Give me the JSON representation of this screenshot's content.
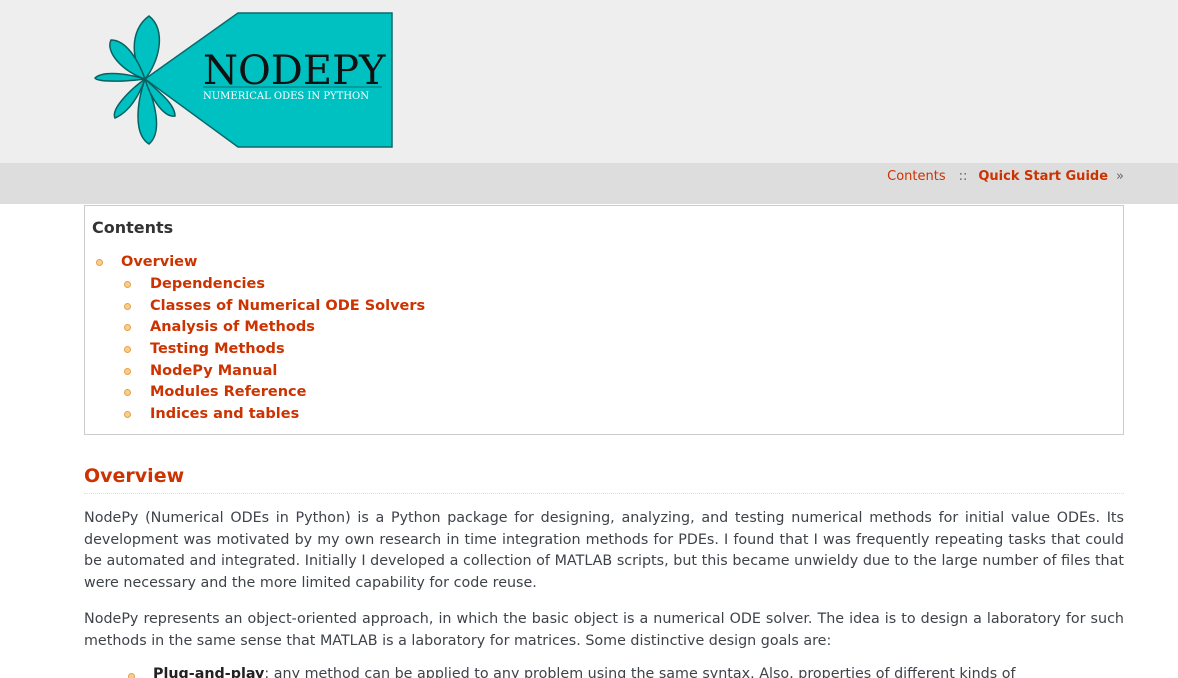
{
  "header": {
    "logo": {
      "title": "NODEPY",
      "subtitle": "NUMERICAL ODES IN PYTHON",
      "icon": "flower-logo-icon",
      "color": "#00c1c1"
    }
  },
  "relbar": {
    "contents_label": "Contents",
    "separator": "::",
    "next_label": "Quick Start Guide",
    "next_arrow": "»"
  },
  "toc": {
    "title": "Contents",
    "top_item": "Overview",
    "items": [
      "Dependencies",
      "Classes of Numerical ODE Solvers",
      "Analysis of Methods",
      "Testing Methods",
      "NodePy Manual",
      "Modules Reference",
      "Indices and tables"
    ]
  },
  "main": {
    "heading": "Overview",
    "para1": "NodePy (Numerical ODEs in Python) is a Python package for designing, analyzing, and testing numerical methods for initial value ODEs. Its development was motivated by my own research in time integration methods for PDEs. I found that I was frequently repeating tasks that could be automated and integrated. Initially I developed a collection of MATLAB scripts, but this became unwieldy due to the large number of files that were necessary and the more limited capability for code reuse.",
    "para2": "NodePy represents an object-oriented approach, in which the basic object is a numerical ODE solver. The idea is to design a laboratory for such methods in the same sense that MATLAB is a laboratory for matrices. Some distinctive design goals are:",
    "goal1_bold": "Plug-and-play",
    "goal1_text": ": any method can be applied to any problem using the same syntax. Also, properties of different kinds of"
  },
  "colors": {
    "accent": "#cc3300",
    "header_bg": "#eeeeee",
    "relbar_bg": "#dddddd"
  }
}
